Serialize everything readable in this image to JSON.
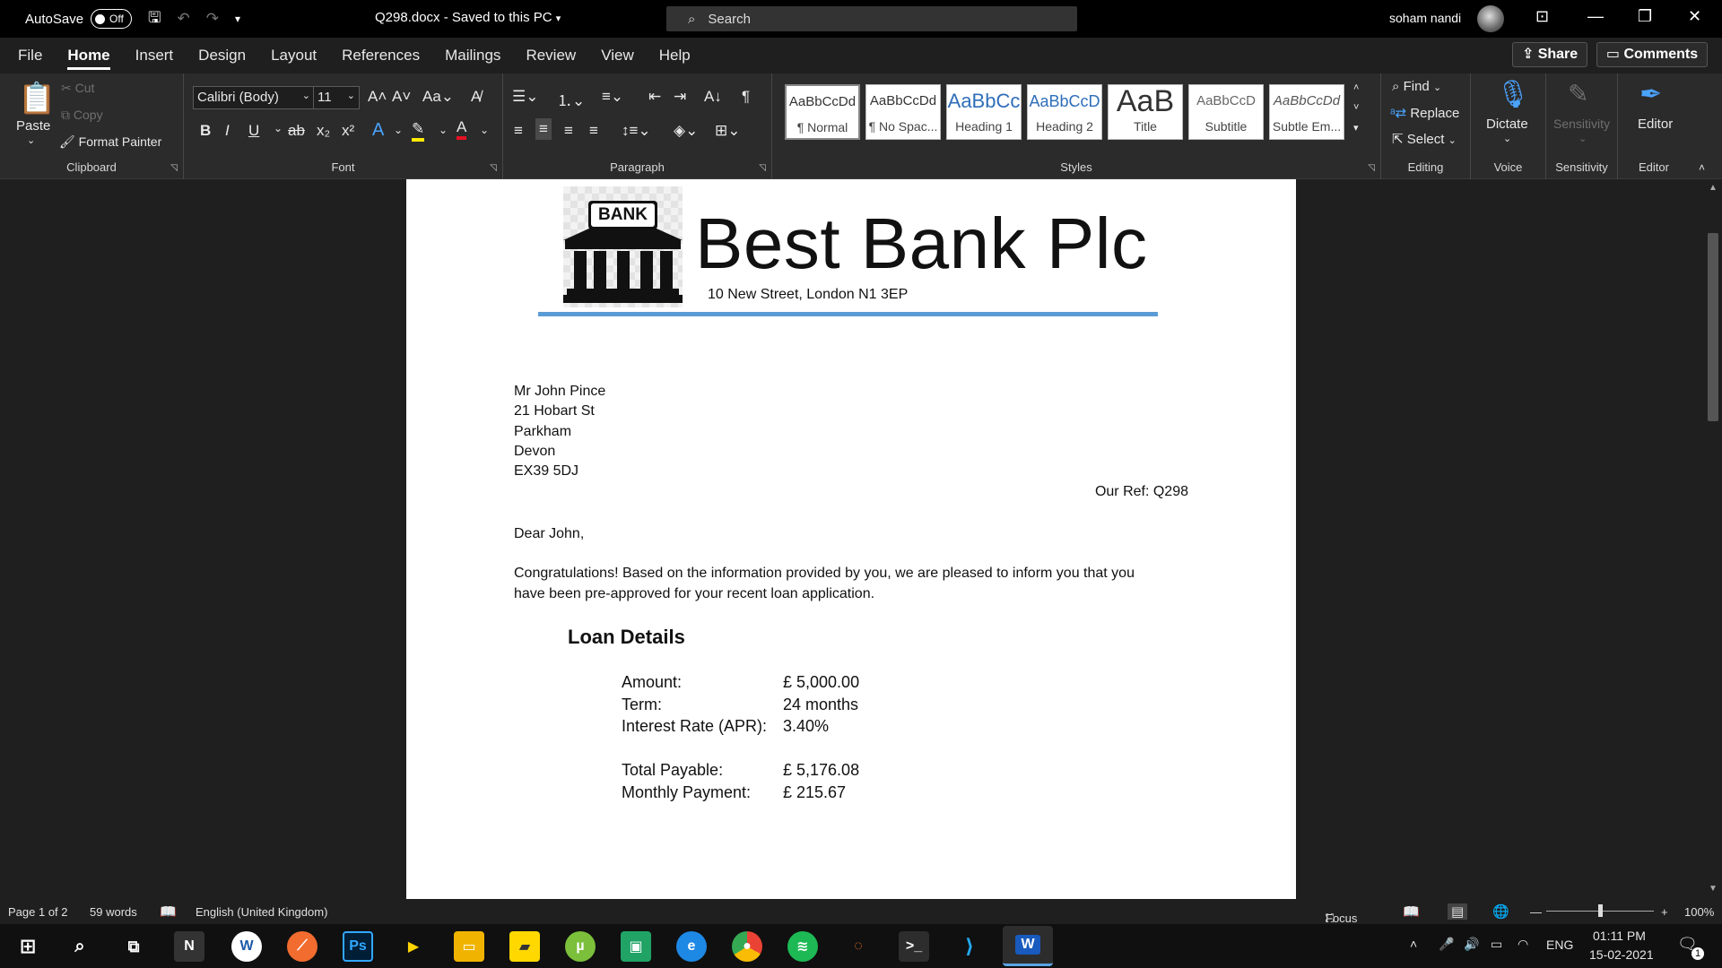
{
  "titlebar": {
    "autosave_label": "AutoSave",
    "autosave_state": "Off",
    "document_title": "Q298.docx  -  Saved to this PC",
    "search_placeholder": "Search",
    "user_name": "soham nandi"
  },
  "menu": {
    "tabs": [
      "File",
      "Home",
      "Insert",
      "Design",
      "Layout",
      "References",
      "Mailings",
      "Review",
      "View",
      "Help"
    ],
    "active_tab": "Home",
    "share_label": "Share",
    "comments_label": "Comments"
  },
  "ribbon": {
    "clipboard": {
      "paste": "Paste",
      "cut": "Cut",
      "copy": "Copy",
      "format_painter": "Format Painter",
      "label": "Clipboard"
    },
    "font": {
      "font_name": "Calibri (Body)",
      "font_size": "11",
      "label": "Font"
    },
    "paragraph": {
      "label": "Paragraph"
    },
    "styles": {
      "label": "Styles",
      "items": [
        {
          "preview": "AaBbCcDd",
          "name": "¶ Normal"
        },
        {
          "preview": "AaBbCcDd",
          "name": "¶ No Spac..."
        },
        {
          "preview": "AaBbCc",
          "name": "Heading 1"
        },
        {
          "preview": "AaBbCcD",
          "name": "Heading 2"
        },
        {
          "preview": "AaB",
          "name": "Title"
        },
        {
          "preview": "AaBbCcD",
          "name": "Subtitle"
        },
        {
          "preview": "AaBbCcDd",
          "name": "Subtle Em..."
        }
      ]
    },
    "editing": {
      "find": "Find",
      "replace": "Replace",
      "select": "Select",
      "label": "Editing"
    },
    "voice": {
      "dictate": "Dictate",
      "label": "Voice"
    },
    "sensitivity": {
      "button": "Sensitivity",
      "label": "Sensitivity"
    },
    "editor": {
      "button": "Editor",
      "label": "Editor"
    }
  },
  "document": {
    "logo_text": "BANK",
    "bank_name": "Best Bank Plc",
    "bank_address": "10 New Street, London N1 3EP",
    "recipient": [
      "Mr John Pince",
      "21 Hobart St",
      "Parkham",
      "Devon",
      "EX39 5DJ"
    ],
    "reference": "Our Ref: Q298",
    "salutation": "Dear John,",
    "body_line1": "Congratulations! Based on the information provided by you, we are pleased to inform you that you",
    "body_line2": "have been pre-approved for your recent loan application.",
    "loan_heading": "Loan Details",
    "loan_rows": [
      {
        "label": "Amount:",
        "value": " £  5,000.00"
      },
      {
        "label": "Term:",
        "value": "24 months"
      },
      {
        "label": "Interest Rate (APR):",
        "value": "3.40%"
      },
      {
        "label": "Total Payable:",
        "value": " £  5,176.08"
      },
      {
        "label": "Monthly Payment:",
        "value": " £  215.67"
      }
    ]
  },
  "statusbar": {
    "page": "Page 1 of 2",
    "words": "59 words",
    "language": "English (United Kingdom)",
    "focus": "Focus",
    "zoom": "100%"
  },
  "taskbar": {
    "language": "ENG",
    "time": "01:11 PM",
    "date": "15-02-2021",
    "notifications": "1"
  }
}
